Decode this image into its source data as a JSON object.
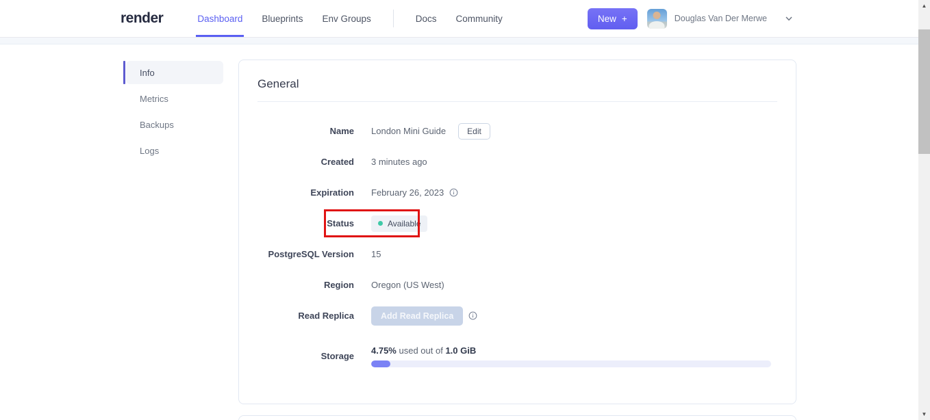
{
  "navbar": {
    "logo": "render",
    "links": [
      {
        "label": "Dashboard",
        "active": true
      },
      {
        "label": "Blueprints",
        "active": false
      },
      {
        "label": "Env Groups",
        "active": false
      },
      {
        "label": "Docs",
        "active": false
      },
      {
        "label": "Community",
        "active": false
      }
    ],
    "new_button": {
      "label": "New",
      "plus": "+"
    },
    "user": {
      "name": "Douglas Van Der Merwe"
    }
  },
  "sidebar": {
    "active_item": "Info",
    "items": [
      {
        "label": "Info"
      },
      {
        "label": "Metrics"
      },
      {
        "label": "Backups"
      },
      {
        "label": "Logs"
      }
    ]
  },
  "general_card": {
    "title": "General",
    "rows": {
      "name": {
        "label": "Name",
        "value": "London Mini Guide",
        "edit_button": "Edit"
      },
      "created": {
        "label": "Created",
        "value": "3 minutes ago"
      },
      "expiration": {
        "label": "Expiration",
        "value": "February 26, 2023",
        "info_icon": "info-icon"
      },
      "status": {
        "label": "Status",
        "badge": "Available",
        "annotated": true
      },
      "postgres_version": {
        "label": "PostgreSQL Version",
        "value": "15"
      },
      "region": {
        "label": "Region",
        "value": "Oregon (US West)"
      },
      "read_replica": {
        "label": "Read Replica",
        "button": "Add Read Replica",
        "button_disabled": true,
        "info_icon": "info-icon"
      },
      "storage": {
        "label": "Storage",
        "percent_used": "4.75%",
        "middle_text": " used out of ",
        "total": "1.0 GiB",
        "percent_value": 4.75
      }
    }
  },
  "annotation": {
    "type": "red-box",
    "target": "status-row"
  },
  "colors": {
    "accent_purple": "#5a5ff2",
    "status_dot_green": "#3ec9a7",
    "annotation_red": "#e01313",
    "progress_fill": "#7b82f5",
    "disabled_button_bg": "#c8d4e8"
  }
}
